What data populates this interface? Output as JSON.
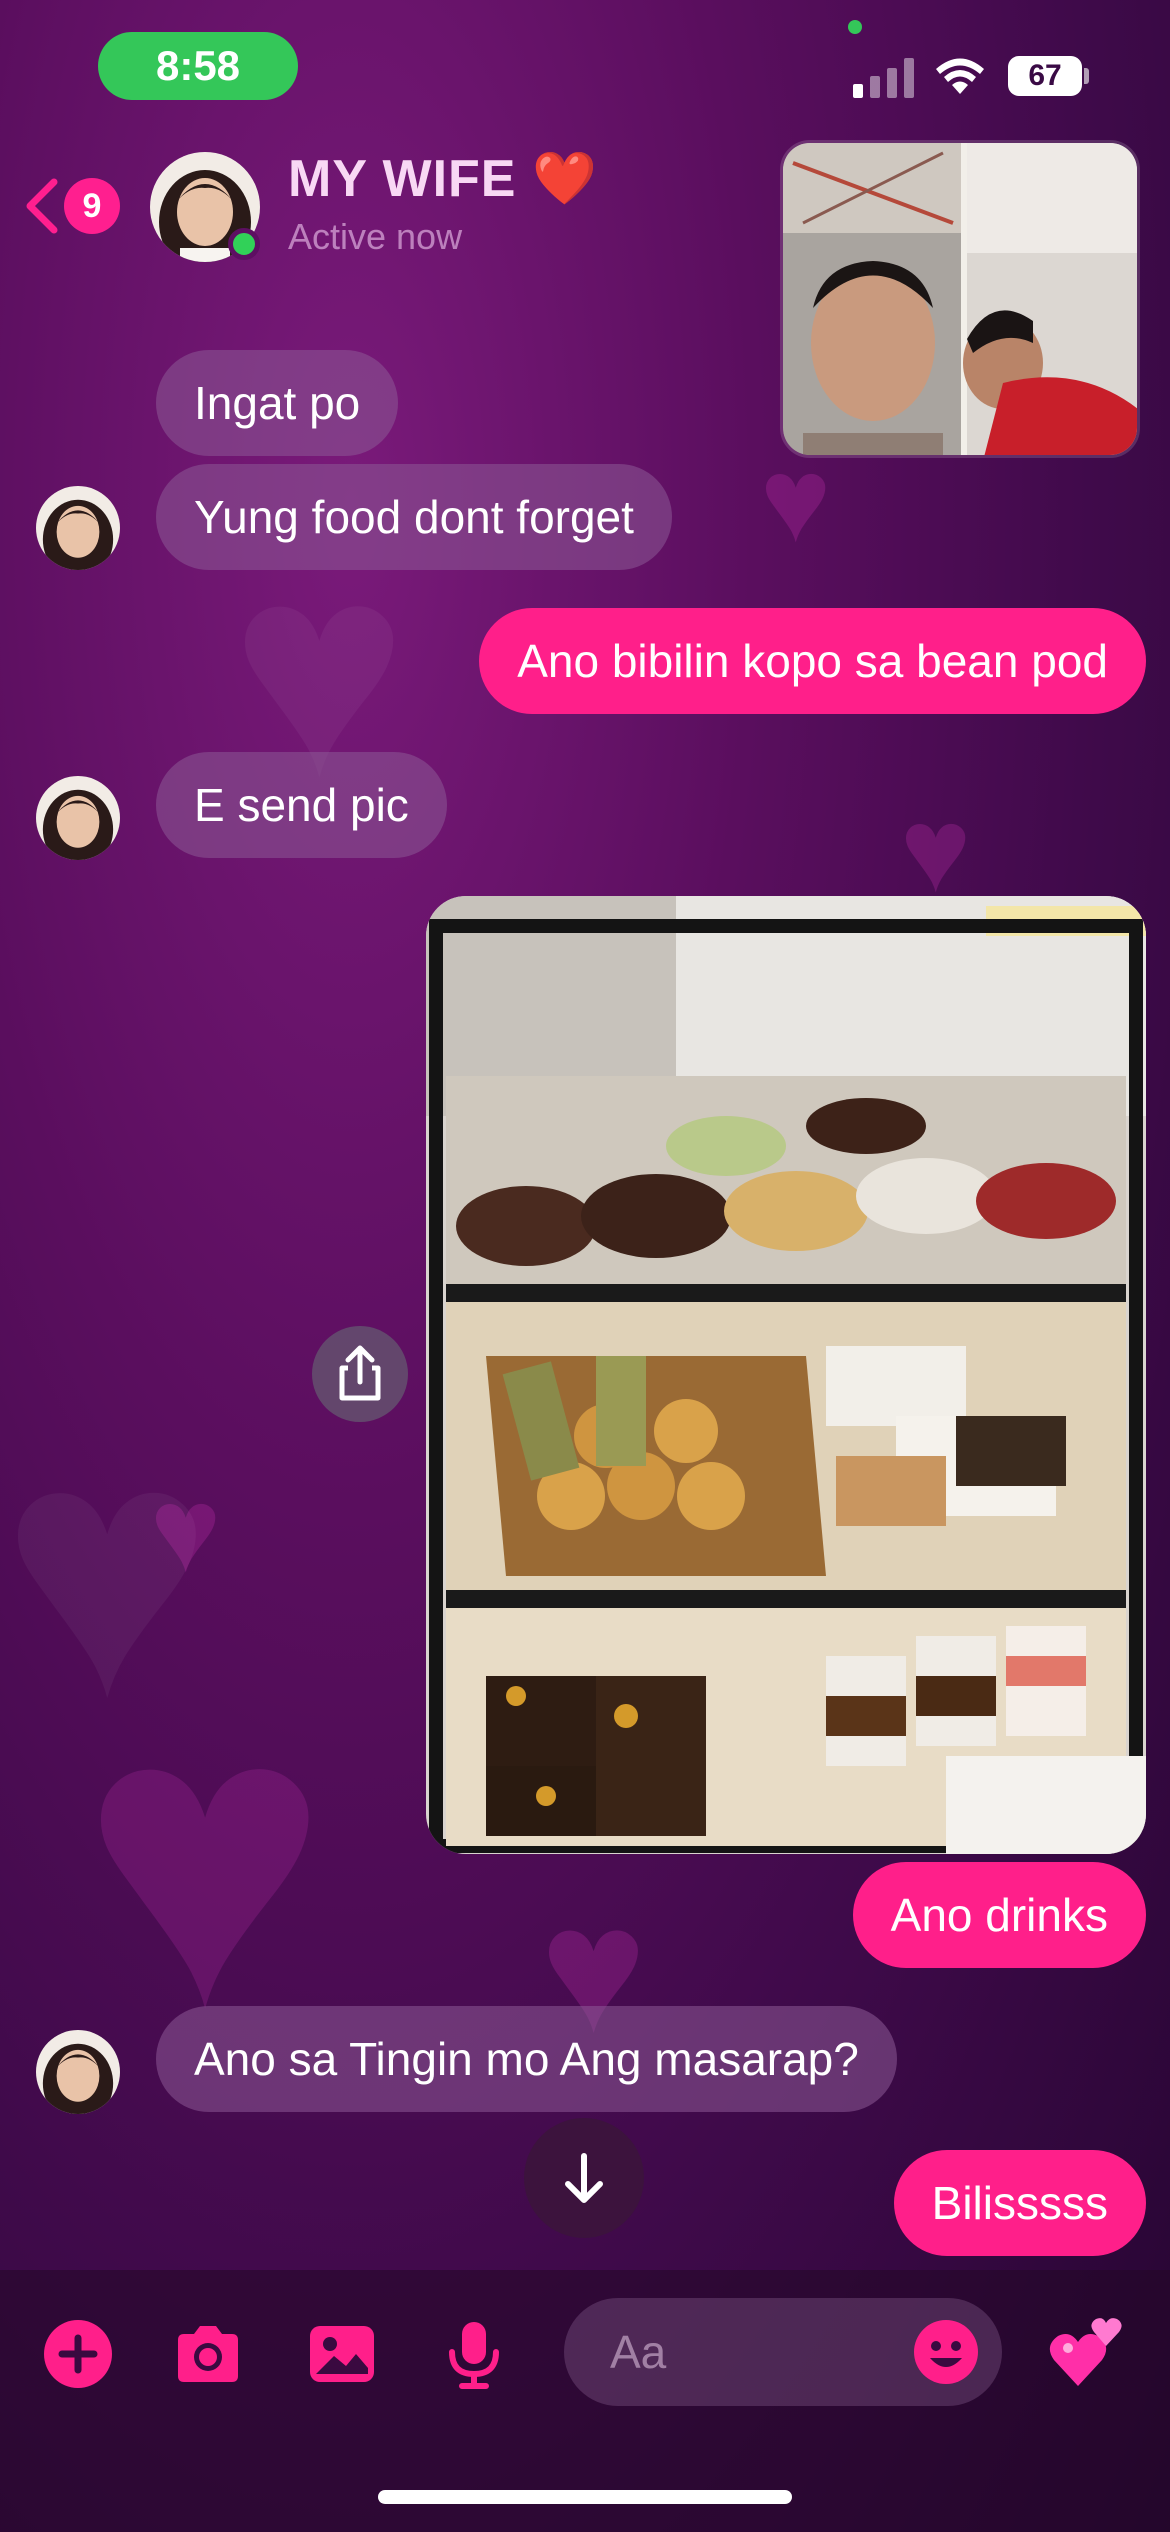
{
  "status_bar": {
    "time": "8:58",
    "battery": "67",
    "icons": [
      "cellular-signal-icon",
      "wifi-icon",
      "battery-icon"
    ]
  },
  "header": {
    "unread_count": "9",
    "contact_name": "MY WIFE",
    "contact_emoji": "❤️",
    "status": "Active now"
  },
  "messages": [
    {
      "side": "in",
      "text": "Ingat po"
    },
    {
      "side": "in",
      "text": "Yung food dont forget"
    },
    {
      "side": "out",
      "text": "Ano bibilin kopo sa bean pod"
    },
    {
      "side": "in",
      "text": "E send pic"
    },
    {
      "side": "out",
      "type": "photo"
    },
    {
      "side": "out",
      "text": "Ano drinks"
    },
    {
      "side": "in",
      "text": "Ano sa Tingin mo Ang masarap?"
    },
    {
      "side": "out",
      "text": "Bilisssss"
    }
  ],
  "composer": {
    "placeholder": "Aa",
    "tools": [
      "add-icon",
      "camera-icon",
      "gallery-icon",
      "microphone-icon",
      "emoji-icon",
      "hearts-icon"
    ]
  },
  "colors": {
    "accent": "#ff1f8a",
    "background": "#5a0e5e",
    "incoming_bubble": "#7d4f88",
    "online": "#31d158"
  }
}
